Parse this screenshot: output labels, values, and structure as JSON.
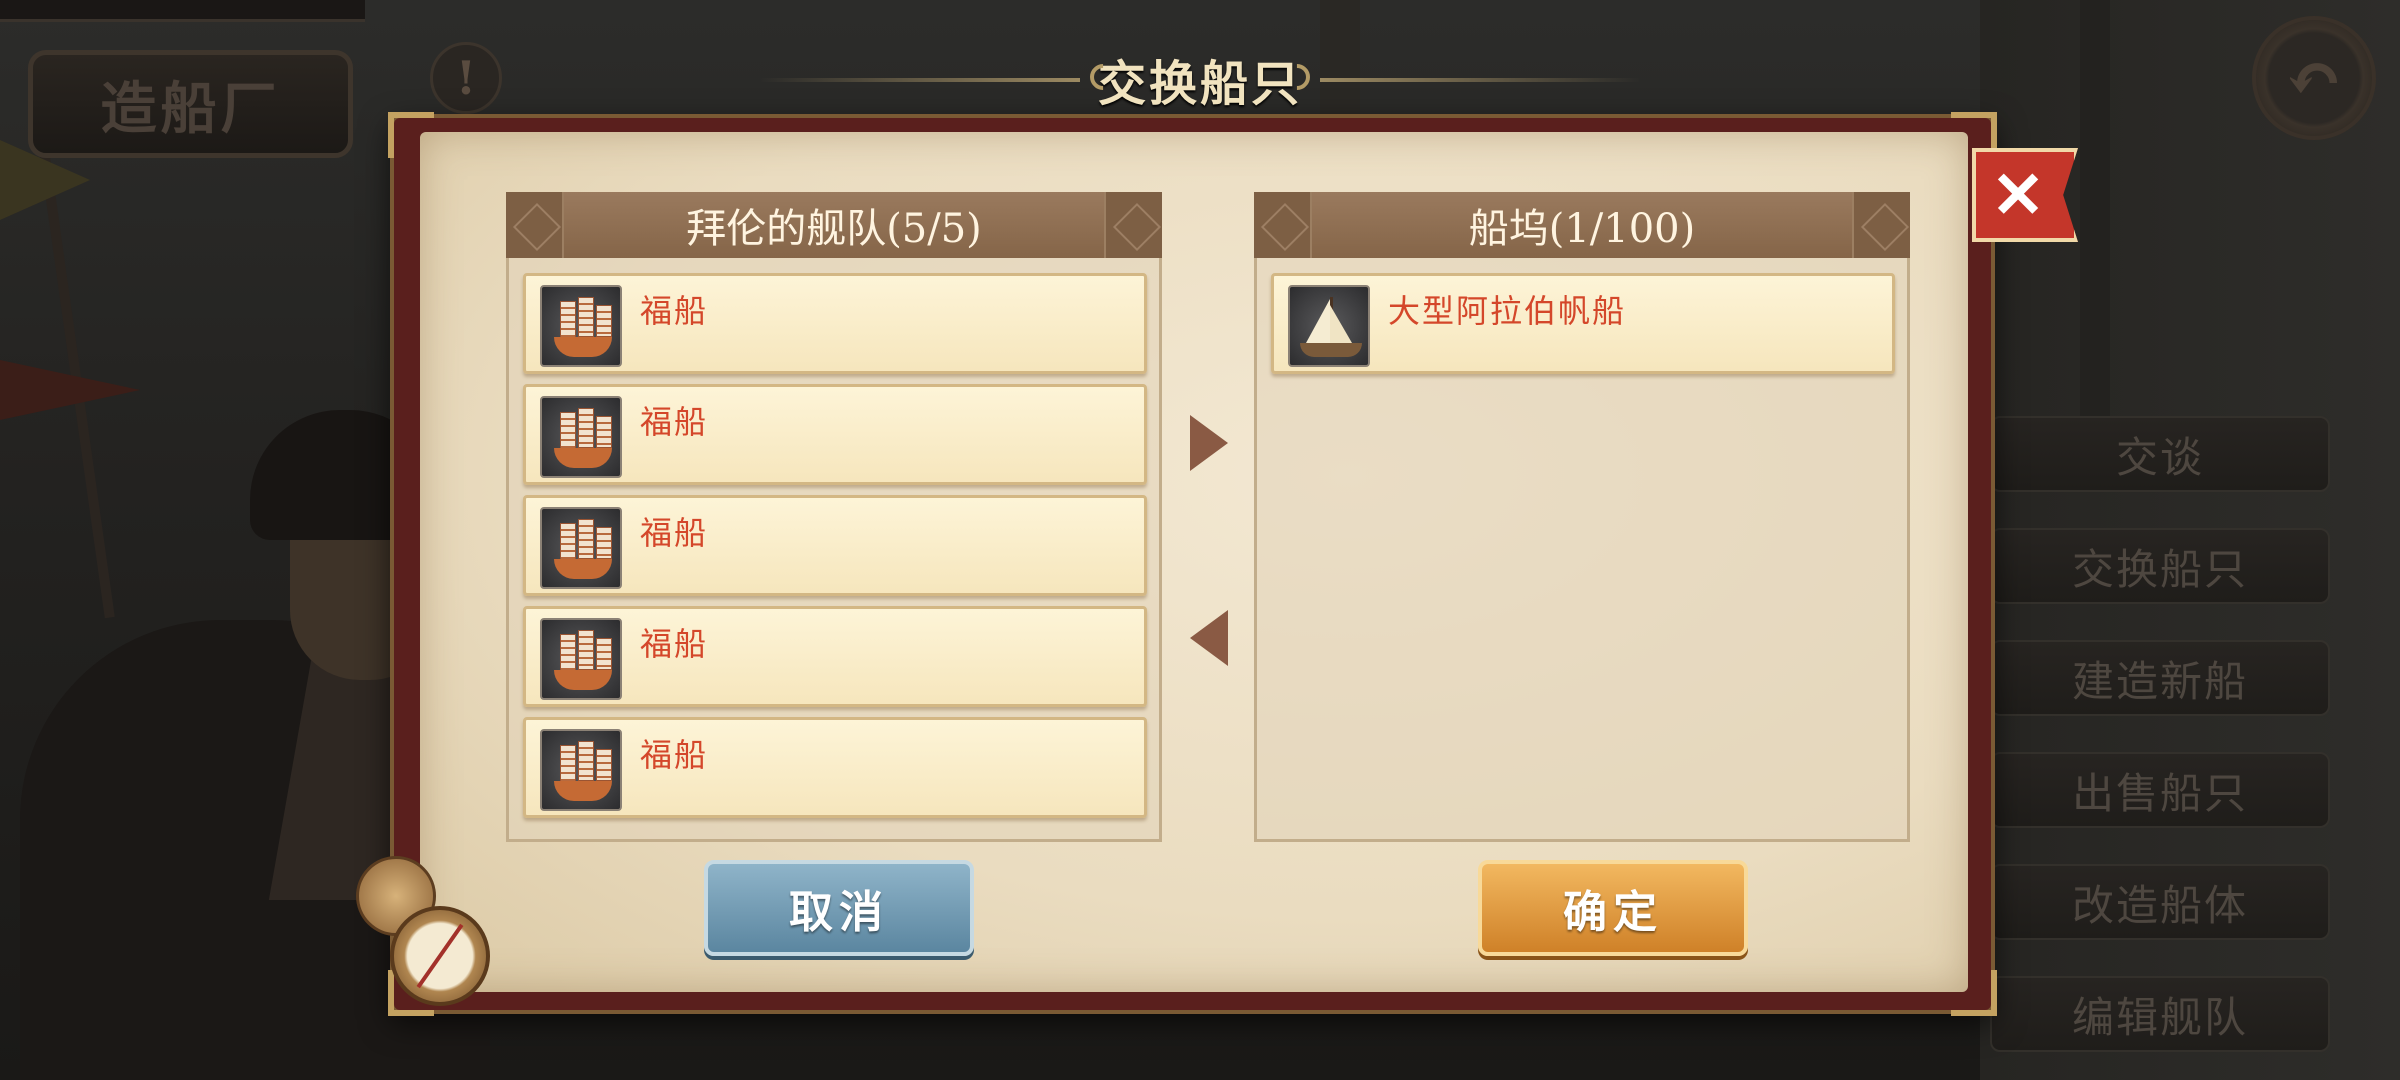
{
  "background": {
    "sign_label": "造船厂",
    "alert_glyph": "!",
    "side_menu": [
      "交谈",
      "交换船只",
      "建造新船",
      "出售船只",
      "改造船体",
      "编辑舰队"
    ]
  },
  "dialog": {
    "title": "交换船只",
    "close_glyph": "✕",
    "fleet_panel": {
      "title": "拜伦的舰队(5/5)",
      "ships": [
        {
          "name": "福船",
          "icon": "junk-ship-icon"
        },
        {
          "name": "福船",
          "icon": "junk-ship-icon"
        },
        {
          "name": "福船",
          "icon": "junk-ship-icon"
        },
        {
          "name": "福船",
          "icon": "junk-ship-icon"
        },
        {
          "name": "福船",
          "icon": "junk-ship-icon"
        }
      ]
    },
    "dock_panel": {
      "title": "船坞(1/100)",
      "ships": [
        {
          "name": "大型阿拉伯帆船",
          "icon": "dhow-ship-icon"
        }
      ]
    },
    "buttons": {
      "cancel": "取消",
      "confirm": "确定"
    }
  },
  "colors": {
    "ship_name": "#d4472a",
    "panel_header": "#8f6f53",
    "cancel_button": "#6f98b0",
    "confirm_button": "#e19a3e",
    "close_button": "#c4362a"
  }
}
